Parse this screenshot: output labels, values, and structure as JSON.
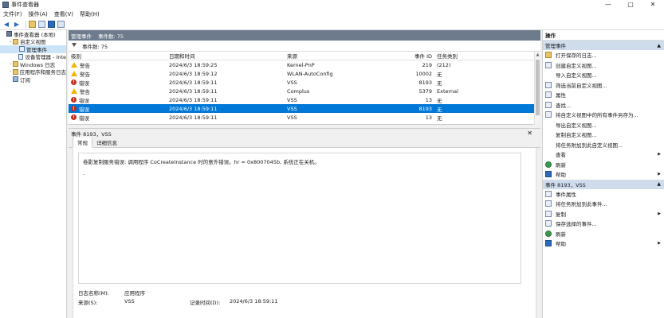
{
  "window": {
    "title": "事件查看器",
    "controls": [
      "—",
      "▢",
      "✕"
    ]
  },
  "menu": [
    "文件(F)",
    "操作(A)",
    "查看(V)",
    "帮助(H)"
  ],
  "toolbar_icons": [
    "back-arrow-icon",
    "forward-arrow-icon",
    "folder-icon",
    "grid-icon",
    "help-icon",
    "panel-icon"
  ],
  "tree": [
    {
      "label": "事件查看器 (本地)",
      "level": 0,
      "twisty": "",
      "icon": "root"
    },
    {
      "label": "自定义视图",
      "level": 1,
      "twisty": "⌄",
      "icon": "folder"
    },
    {
      "label": "管理事件",
      "level": 2,
      "twisty": "",
      "icon": "filter",
      "selected": true
    },
    {
      "label": "设备管理器 - Inte",
      "level": 2,
      "twisty": "",
      "icon": "filter"
    },
    {
      "label": "Windows 日志",
      "level": 1,
      "twisty": "›",
      "icon": "folder"
    },
    {
      "label": "应用程序和服务日志",
      "level": 1,
      "twisty": "›",
      "icon": "folder"
    },
    {
      "label": "订阅",
      "level": 1,
      "twisty": "",
      "icon": "log"
    }
  ],
  "center": {
    "header_title": "管理事件",
    "header_count": "事件数: 75",
    "filter_text": "事件数: 75",
    "columns": {
      "level": "级别",
      "date": "日期和时间",
      "source": "来源",
      "id": "事件 ID",
      "category": "任务类别"
    },
    "rows": [
      {
        "level": "警告",
        "type": "warn",
        "date": "2024/6/3 18:59:25",
        "source": "Kernel-PnP",
        "id": "219",
        "category": "(212)"
      },
      {
        "level": "警告",
        "type": "warn",
        "date": "2024/6/3 18:59:12",
        "source": "WLAN-AutoConfig",
        "id": "10002",
        "category": "无"
      },
      {
        "level": "错误",
        "type": "err",
        "date": "2024/6/3 18:59:11",
        "source": "VSS",
        "id": "8193",
        "category": "无"
      },
      {
        "level": "警告",
        "type": "warn",
        "date": "2024/6/3 18:59:11",
        "source": "Complus",
        "id": "5379",
        "category": "External"
      },
      {
        "level": "错误",
        "type": "err",
        "date": "2024/6/3 18:59:11",
        "source": "VSS",
        "id": "13",
        "category": "无"
      },
      {
        "level": "错误",
        "type": "err",
        "date": "2024/6/3 18:59:11",
        "source": "VSS",
        "id": "8193",
        "category": "无",
        "selected": true
      },
      {
        "level": "错误",
        "type": "err",
        "date": "2024/6/3 18:59:11",
        "source": "VSS",
        "id": "13",
        "category": "无"
      }
    ],
    "detail": {
      "title": "事件 8193，VSS",
      "tabs": [
        "常规",
        "详细信息"
      ],
      "message": "卷影复制服务错误: 调用程序 CoCreateInstance 时的意外错误。hr = 0x8007045b, 系统正在关机。",
      "log_name_label": "日志名称(M):",
      "log_name_value": "应用程序",
      "source_label": "来源(S):",
      "source_value": "VSS",
      "logged_label": "记录时间(D):",
      "logged_value": "2024/6/3 18:59:11"
    }
  },
  "actions": {
    "title": "操作",
    "section1": {
      "title": "管理事件",
      "items": [
        {
          "label": "打开保存的日志...",
          "icon": "folder",
          "submenu": false
        },
        {
          "label": "创建自定义视图...",
          "icon": "filter",
          "submenu": false
        },
        {
          "label": "导入自定义视图...",
          "icon": "none",
          "submenu": false
        },
        {
          "label": "筛选当前自定义视图...",
          "icon": "filter",
          "submenu": false
        },
        {
          "label": "属性",
          "icon": "default",
          "submenu": false
        },
        {
          "label": "查找...",
          "icon": "default",
          "submenu": false
        },
        {
          "label": "将自定义视图中的所有事件另存为...",
          "icon": "default",
          "submenu": false
        },
        {
          "label": "导出自定义视图...",
          "icon": "none",
          "submenu": false
        },
        {
          "label": "复制自定义视图...",
          "icon": "none",
          "submenu": false
        },
        {
          "label": "将任务附加到此自定义视图...",
          "icon": "none",
          "submenu": false
        },
        {
          "label": "查看",
          "icon": "none",
          "submenu": true
        },
        {
          "label": "刷新",
          "icon": "green",
          "submenu": false
        },
        {
          "label": "帮助",
          "icon": "help",
          "submenu": true
        }
      ]
    },
    "section2": {
      "title": "事件 8193，VSS",
      "items": [
        {
          "label": "事件属性",
          "icon": "default",
          "submenu": false
        },
        {
          "label": "将任务附加到此事件...",
          "icon": "default",
          "submenu": false
        },
        {
          "label": "复制",
          "icon": "default",
          "submenu": true
        },
        {
          "label": "保存选择的事件...",
          "icon": "default",
          "submenu": false
        },
        {
          "label": "刷新",
          "icon": "green",
          "submenu": false
        },
        {
          "label": "帮助",
          "icon": "help",
          "submenu": true
        }
      ]
    }
  }
}
